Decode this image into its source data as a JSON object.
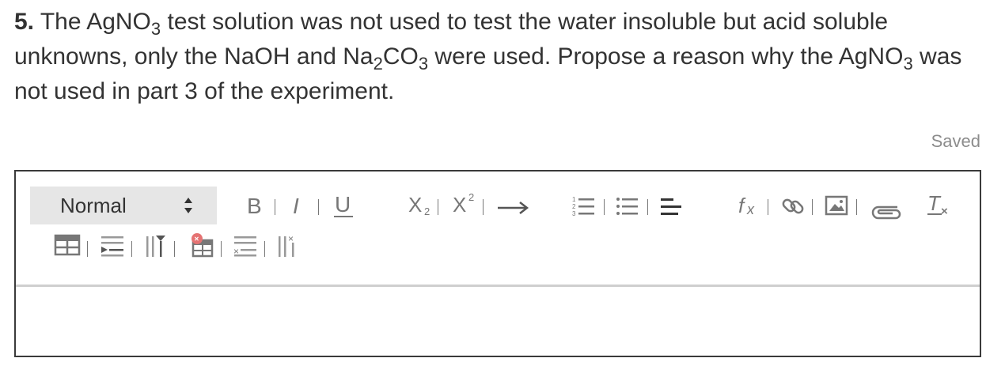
{
  "question": {
    "number": "5.",
    "seg1": " The AgNO",
    "sub1": "3",
    "seg2": " test solution was not used to test the water insoluble but acid soluble unknowns, only the NaOH and Na",
    "sub2": "2",
    "seg3": "CO",
    "sub3": "3",
    "seg4": " were used. Propose a reason why the AgNO",
    "sub4": "3",
    "seg5": " was not used in part 3 of the experiment."
  },
  "status": {
    "saved": "Saved"
  },
  "toolbar": {
    "format_select": {
      "value": "Normal"
    },
    "buttons": [
      {
        "name": "bold",
        "icon": "bold-icon"
      },
      {
        "name": "italic",
        "icon": "italic-icon"
      },
      {
        "name": "underline",
        "icon": "underline-icon"
      },
      {
        "name": "subscript",
        "icon": "subscript-icon"
      },
      {
        "name": "superscript",
        "icon": "superscript-icon"
      },
      {
        "name": "arrow",
        "icon": "right-arrow-icon"
      },
      {
        "name": "ordered-list",
        "icon": "ordered-list-icon"
      },
      {
        "name": "bullet-list",
        "icon": "bullet-list-icon"
      },
      {
        "name": "align",
        "icon": "align-icon"
      },
      {
        "name": "formula",
        "icon": "formula-icon"
      },
      {
        "name": "link",
        "icon": "link-icon"
      },
      {
        "name": "image",
        "icon": "image-icon"
      },
      {
        "name": "attachment",
        "icon": "paperclip-icon"
      },
      {
        "name": "clear-format",
        "icon": "clear-format-icon"
      },
      {
        "name": "insert-table",
        "icon": "table-icon"
      },
      {
        "name": "insert-row",
        "icon": "insert-row-icon"
      },
      {
        "name": "insert-column",
        "icon": "insert-column-icon"
      },
      {
        "name": "delete-table",
        "icon": "delete-table-icon"
      },
      {
        "name": "delete-row",
        "icon": "delete-row-icon"
      },
      {
        "name": "delete-column",
        "icon": "delete-column-icon"
      }
    ]
  },
  "colors": {
    "text": "#333333",
    "icon": "#777777",
    "select_bg": "#e6e6e6",
    "border": "#3a3a3a",
    "divider": "#cfcfcf",
    "delete_badge": "#e57373"
  }
}
